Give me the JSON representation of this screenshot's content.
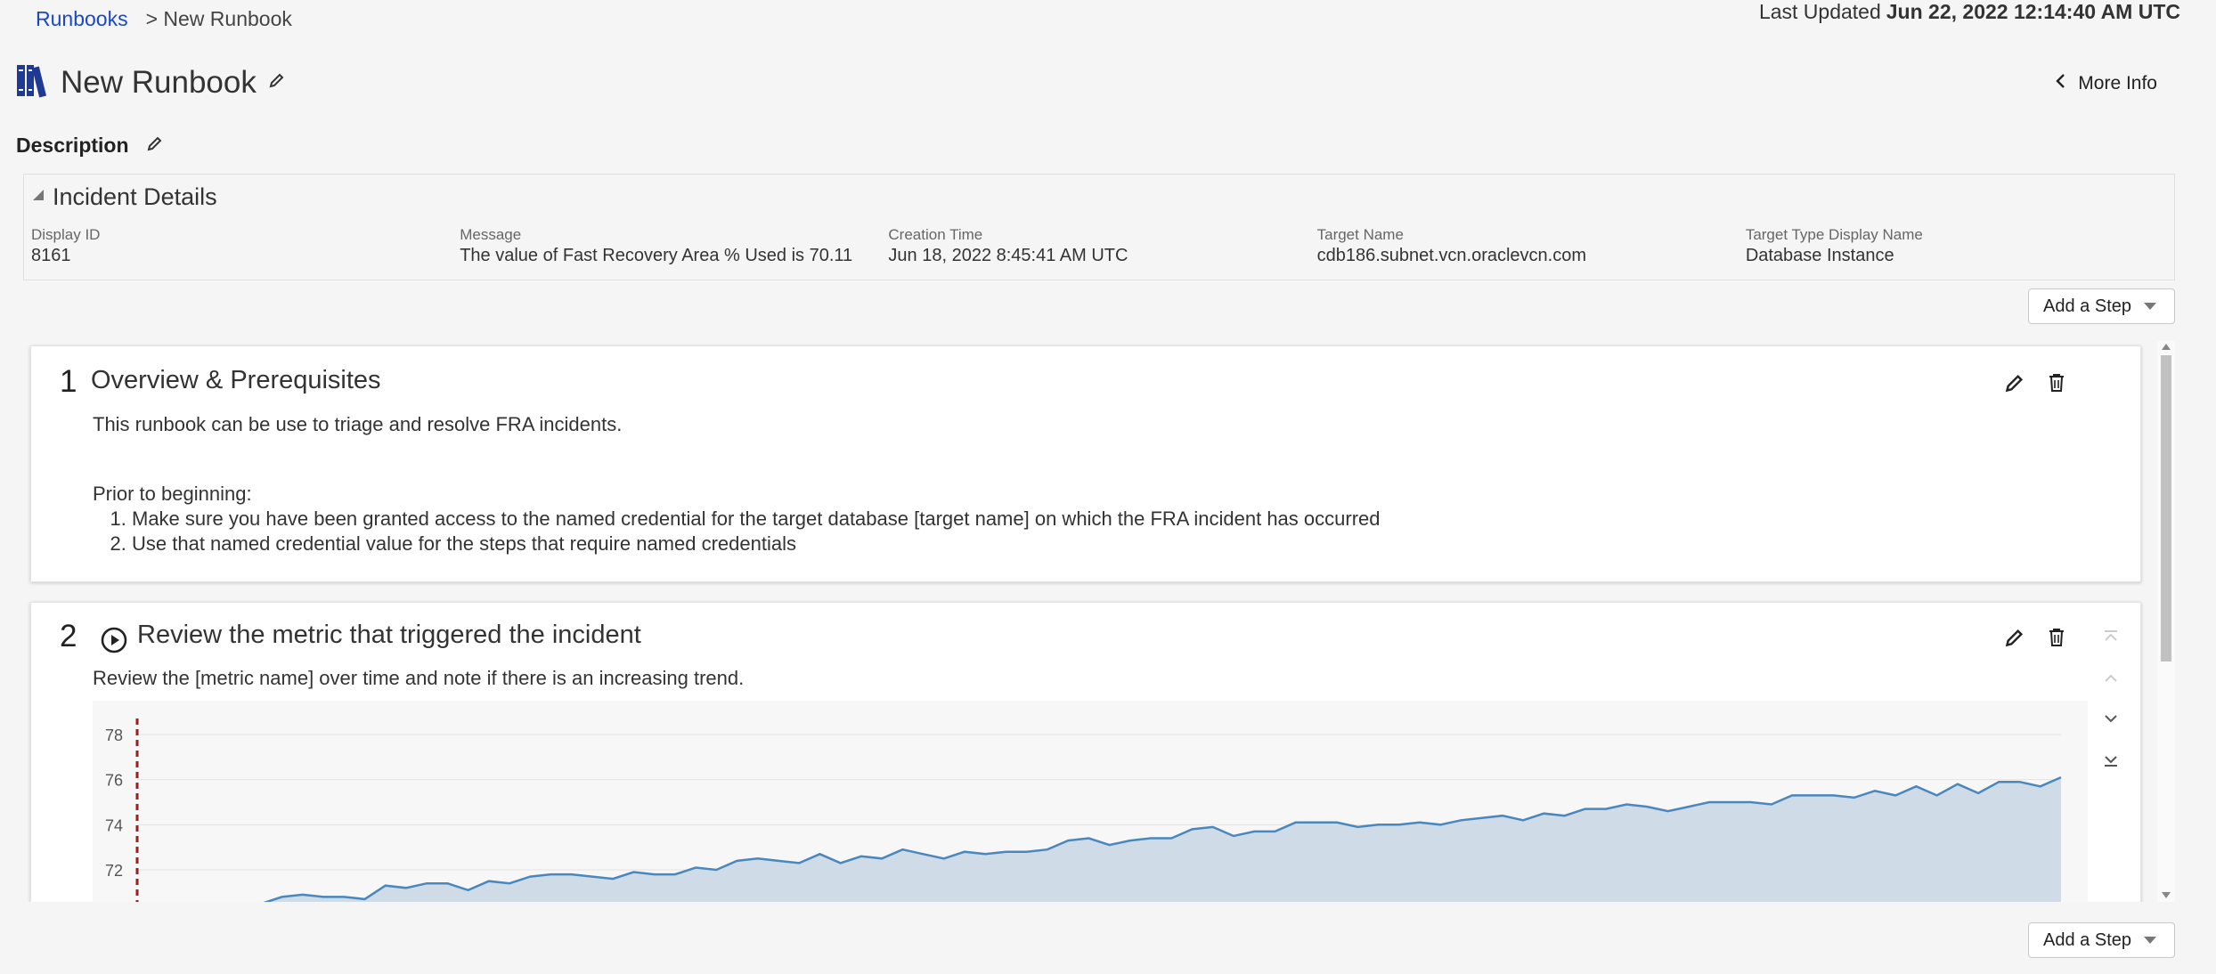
{
  "breadcrumb": {
    "root": "Runbooks",
    "separator": ">",
    "current": "New Runbook"
  },
  "last_updated": {
    "label": "Last Updated",
    "value": "Jun 22, 2022 12:14:40 AM UTC"
  },
  "page": {
    "title": "New Runbook",
    "description_label": "Description",
    "more_info": "More Info"
  },
  "incident": {
    "title": "Incident Details",
    "fields": [
      {
        "label": "Display ID",
        "value": "8161"
      },
      {
        "label": "Message",
        "value": "The value of Fast Recovery Area % Used is 70.11"
      },
      {
        "label": "Creation Time",
        "value": "Jun 18, 2022 8:45:41 AM UTC"
      },
      {
        "label": "Target Name",
        "value": "cdb186.subnet.vcn.oraclevcn.com"
      },
      {
        "label": "Target Type Display Name",
        "value": "Database Instance"
      }
    ]
  },
  "add_step_label": "Add a Step",
  "steps": [
    {
      "number": "1",
      "title": "Overview & Prerequisites",
      "intro": "This runbook can be use to triage and resolve FRA incidents.",
      "prior": "Prior to beginning:",
      "items": [
        "Make sure you have been granted access to the named credential for the target database [target name] on which the FRA incident has occurred",
        "Use that named credential value for the steps that require named credentials"
      ]
    },
    {
      "number": "2",
      "title": "Review the metric that triggered the incident",
      "intro": "Review the [metric name] over time and note if there is an increasing trend."
    }
  ],
  "chart_data": {
    "type": "area",
    "title": "",
    "xlabel": "",
    "ylabel": "",
    "y_ticks": [
      "78",
      "76",
      "74",
      "72"
    ],
    "ylim": [
      70.6,
      78.8
    ],
    "grid": true,
    "marker_line": "vertical dashed red line near start",
    "series": [
      {
        "color": "#4a87bd",
        "values": [
          70.0,
          70.3,
          70.2,
          70.5,
          70.4,
          70.3,
          70.5,
          70.8,
          70.9,
          70.8,
          70.8,
          70.7,
          71.3,
          71.2,
          71.4,
          71.4,
          71.1,
          71.5,
          71.4,
          71.7,
          71.8,
          71.8,
          71.7,
          71.6,
          71.9,
          71.8,
          71.8,
          72.1,
          72.0,
          72.4,
          72.5,
          72.4,
          72.3,
          72.7,
          72.3,
          72.6,
          72.5,
          72.9,
          72.7,
          72.5,
          72.8,
          72.7,
          72.8,
          72.8,
          72.9,
          73.3,
          73.4,
          73.1,
          73.3,
          73.4,
          73.4,
          73.8,
          73.9,
          73.5,
          73.7,
          73.7,
          74.1,
          74.1,
          74.1,
          73.9,
          74.0,
          74.0,
          74.1,
          74.0,
          74.2,
          74.3,
          74.4,
          74.2,
          74.5,
          74.4,
          74.7,
          74.7,
          74.9,
          74.8,
          74.6,
          74.8,
          75.0,
          75.0,
          75.0,
          74.9,
          75.3,
          75.3,
          75.3,
          75.2,
          75.5,
          75.3,
          75.7,
          75.3,
          75.8,
          75.4,
          75.9,
          75.9,
          75.7,
          76.1
        ]
      }
    ]
  }
}
